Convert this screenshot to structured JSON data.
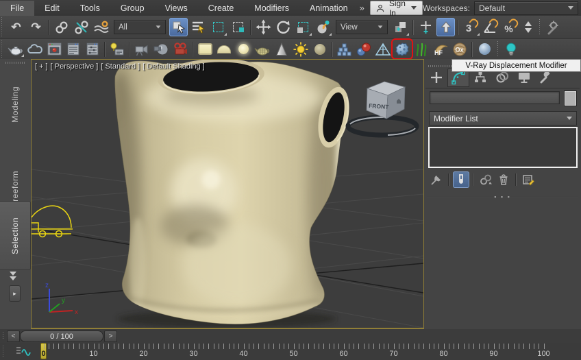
{
  "menubar": {
    "items": [
      "File",
      "Edit",
      "Tools",
      "Group",
      "Views",
      "Create",
      "Modifiers",
      "Animation"
    ],
    "overflow": "»",
    "signin": {
      "label": "Sign In"
    },
    "workspaces": {
      "label": "Workspaces:",
      "value": "Default"
    }
  },
  "toolbar_main": {
    "selection_filter_value": "All",
    "coord_system_value": "View",
    "icons": [
      "undo",
      "redo",
      "select-and-link",
      "unlink-selection",
      "bind-to-space-warp",
      "selection-filter-dropdown",
      "select-object",
      "select-by-name",
      "rectangular-selection-region",
      "window-crossing-toggle",
      "select-and-move",
      "select-and-rotate",
      "select-and-scale",
      "select-and-place",
      "reference-coordinate-system-dropdown",
      "use-pivot-point-center",
      "select-and-manipulate",
      "keyboard-shortcut-override-toggle",
      "snaps-toggle-3d",
      "angle-snap-toggle",
      "percent-snap-toggle",
      "spinner-snap-toggle",
      "scene-brush"
    ],
    "active": [
      "select-object",
      "keyboard-shortcut-override-toggle"
    ]
  },
  "toolbar_vray": {
    "icons": [
      "vray-render",
      "chaos-cloud",
      "vray-frame-buffer",
      "render-settings",
      "render-elements",
      "light-lister",
      "physical-camera",
      "vr-camera",
      "film-camera",
      "vray-plane-light",
      "vray-dome-light",
      "vray-sphere-light",
      "vray-mesh-light",
      "vray-ies-light",
      "vray-sun",
      "vray-sphere-object",
      "vray-proxy",
      "vray-metaball",
      "vray-plane",
      "vray-displacement-modifier",
      "vray-fur",
      "hair-farm",
      "ornatrix",
      "vray-hemisphere",
      "vray-light"
    ],
    "highlighted": "vray-displacement-modifier",
    "hf_label": "HF",
    "ox_label": "Ox"
  },
  "tooltip": {
    "text": "V-Ray Displacement Modifier"
  },
  "ribbon": {
    "tabs": [
      "Modeling",
      "Freeform",
      "Selection"
    ],
    "active": "Selection"
  },
  "viewport": {
    "label_segments": [
      "[ + ]",
      "[ Perspective ]",
      "[ Standard ]",
      "[ Default Shading ]"
    ],
    "viewcube_face": "FRONT",
    "axis_labels": {
      "x": "x",
      "y": "y",
      "z": "z"
    }
  },
  "command_panel": {
    "tabs": [
      "create",
      "modify",
      "hierarchy",
      "motion",
      "display",
      "utilities"
    ],
    "active_tab": "modify",
    "object_name_value": "",
    "modifier_list_label": "Modifier List",
    "stack_items": [],
    "buttons": [
      "pin-stack",
      "show-end-result",
      "make-unique",
      "remove-modifier",
      "configure-modifier-sets"
    ],
    "active_button": "show-end-result"
  },
  "timeline": {
    "frame_display": "0 / 100",
    "prev_label": "<",
    "next_label": ">",
    "current_frame": 0,
    "ruler_labels": [
      "0",
      "10",
      "20",
      "30",
      "40",
      "50",
      "60",
      "70",
      "80",
      "90",
      "100"
    ]
  },
  "colors": {
    "accent_blue": "#5a7fb5",
    "accent_teal": "#2fc5c5",
    "accent_orange": "#e8a33d",
    "highlight_red": "#e21212",
    "viewport_border": "#917f37",
    "model_tan": "#d3c9a3"
  }
}
